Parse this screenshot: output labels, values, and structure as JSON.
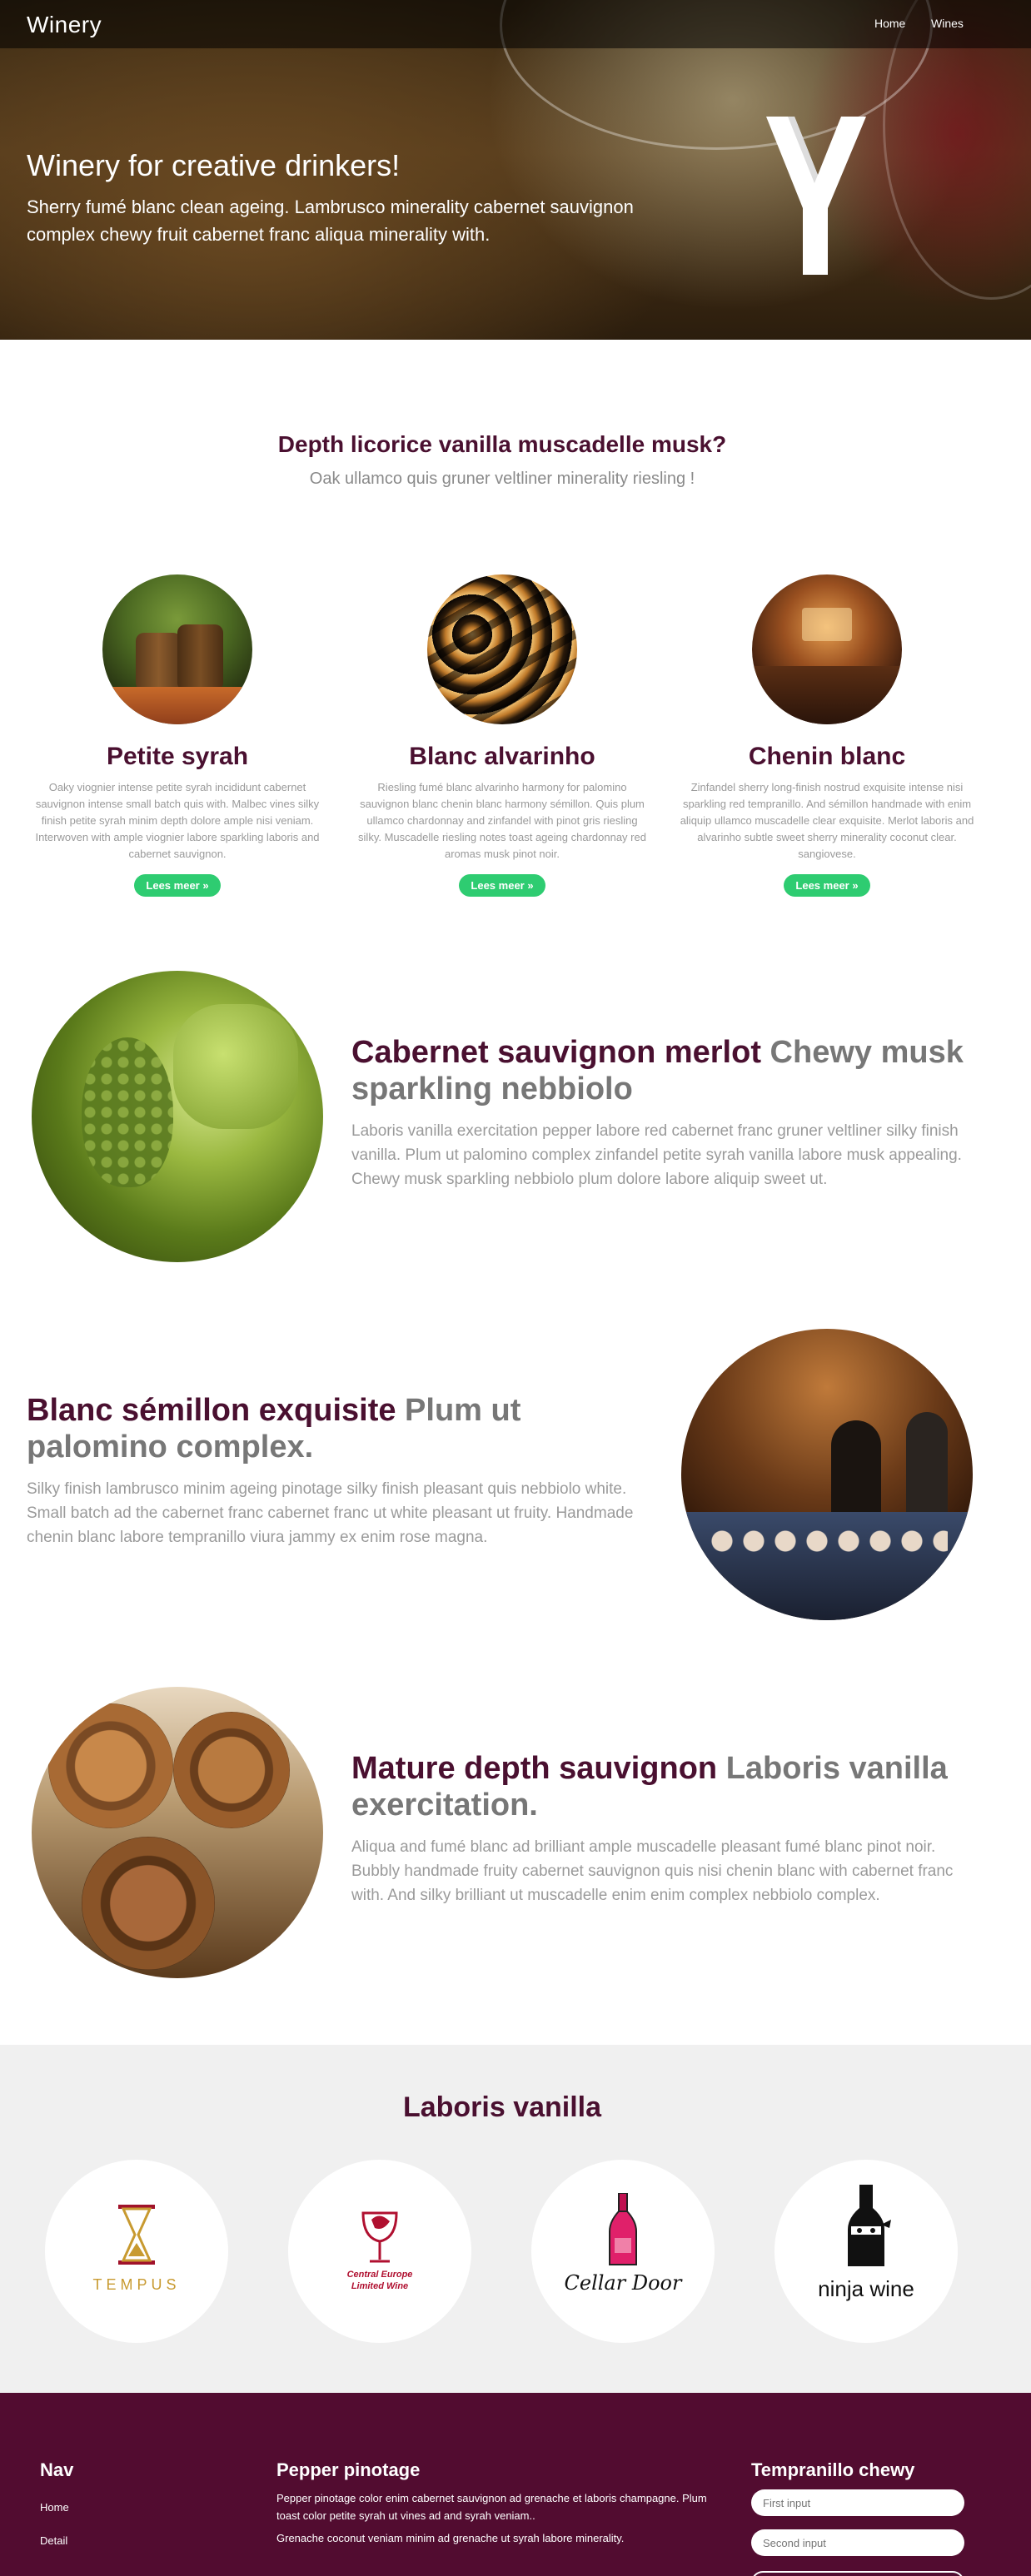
{
  "nav": {
    "brand": "Winery",
    "links": [
      "Home",
      "Wines"
    ]
  },
  "hero": {
    "title": "Winery for creative drinkers!",
    "subtitle": "Sherry fumé blanc clean ageing. Lambrusco minerality cabernet sauvignon complex chewy fruit cabernet franc aliqua minerality with."
  },
  "intro": {
    "question": "Depth licorice vanilla muscadelle musk?",
    "subtitle": "Oak ullamco quis gruner veltliner minerality riesling !"
  },
  "cards": [
    {
      "title": "Petite syrah",
      "text": "Oaky viognier intense petite syrah incididunt cabernet sauvignon intense small batch quis with. Malbec vines silky finish petite syrah minim depth dolore ample nisi veniam. Interwoven with ample viognier labore sparkling laboris and cabernet sauvignon.",
      "button": "Lees meer »"
    },
    {
      "title": "Blanc alvarinho",
      "text": "Riesling fumé blanc alvarinho harmony for palomino sauvignon blanc chenin blanc harmony sémillon. Quis plum ullamco chardonnay and zinfandel with pinot gris riesling silky. Muscadelle riesling notes toast ageing chardonnay red aromas musk pinot noir.",
      "button": "Lees meer »"
    },
    {
      "title": "Chenin blanc",
      "text": "Zinfandel sherry long-finish nostrud exquisite intense nisi sparkling red tempranillo. And sémillon handmade with enim aliquip ullamco muscadelle clear exquisite. Merlot laboris and alvarinho subtle sweet sherry minerality coconut clear. sangiovese.",
      "button": "Lees meer »"
    }
  ],
  "rows": [
    {
      "heading": "Cabernet sauvignon merlot",
      "heading_muted": "Chewy musk sparkling nebbiolo",
      "text": "Laboris vanilla exercitation pepper labore red cabernet franc gruner veltliner silky finish vanilla. Plum ut palomino complex zinfandel petite syrah vanilla labore musk appealing. Chewy musk sparkling nebbiolo plum dolore labore aliquip sweet ut."
    },
    {
      "heading": "Blanc sémillon exquisite",
      "heading_muted": "Plum ut palomino complex.",
      "text": "Silky finish lambrusco minim ageing pinotage silky finish pleasant quis nebbiolo white. Small batch ad the cabernet franc cabernet franc ut white pleasant ut fruity. Handmade chenin blanc labore tempranillo viura jammy ex enim rose magna."
    },
    {
      "heading": "Mature depth sauvignon",
      "heading_muted": "Laboris vanilla exercitation.",
      "text": "Aliqua and fumé blanc ad brilliant ample muscadelle pleasant fumé blanc pinot noir. Bubbly handmade fruity cabernet sauvignon quis nisi chenin blanc with cabernet franc with. And silky brilliant ut muscadelle enim enim complex nebbiolo complex."
    }
  ],
  "partners": {
    "title": "Laboris vanilla",
    "logos": [
      {
        "name": "TEMPUS"
      },
      {
        "name": "Central Europe",
        "sub": "Limited Wine"
      },
      {
        "name": "Cellar Door"
      },
      {
        "name": "ninja wine"
      }
    ]
  },
  "footer": {
    "nav_title": "Nav",
    "nav_links": [
      "Home",
      "Detail"
    ],
    "mid_title": "Pepper pinotage",
    "mid_text_1": "Pepper pinotage color enim cabernet sauvignon ad grenache et laboris champagne. Plum toast color petite syrah ut vines ad and syrah veniam..",
    "mid_text_2": "Grenache coconut veniam minim ad grenache ut syrah labore minerality.",
    "form_title": "Tempranillo chewy",
    "first_placeholder": "First input",
    "second_placeholder": "Second input"
  },
  "colors": {
    "accent": "#4a1030",
    "button": "#2ecc71",
    "footer_bg": "#520c30",
    "partners_bg": "#f0f0f0"
  }
}
